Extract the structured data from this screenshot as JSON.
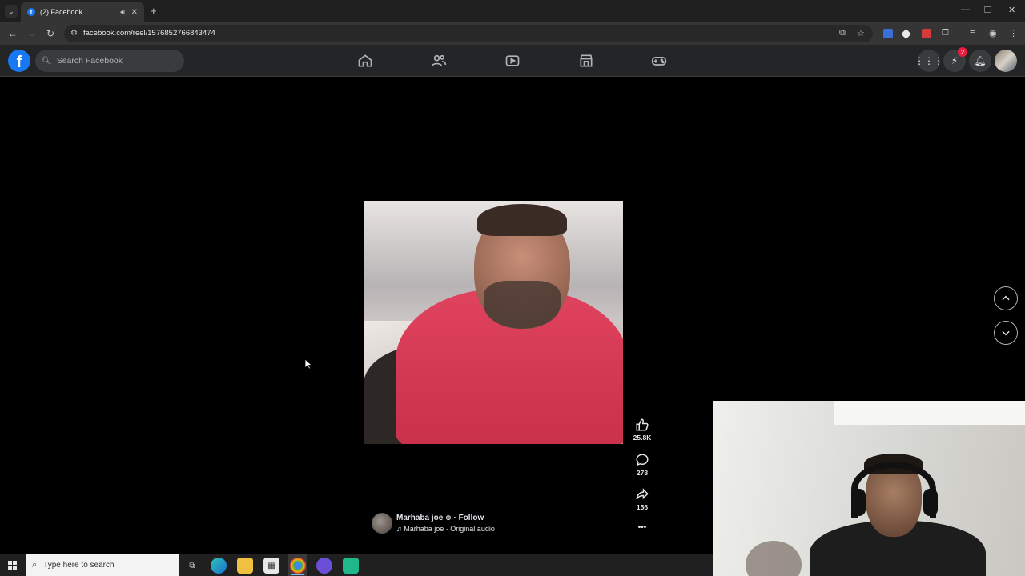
{
  "browser": {
    "tab_title": "(2) Facebook",
    "url": "facebook.com/reel/1576852766843474"
  },
  "facebook": {
    "logo_letter": "f",
    "search_placeholder": "Search Facebook",
    "messenger_badge": "2"
  },
  "reel": {
    "author": "Marhaba joe",
    "follow_label": "Follow",
    "audio": "Marhaba joe · Original audio",
    "likes": "25.8K",
    "comments": "278",
    "shares": "156",
    "more_label": "•••"
  },
  "taskbar": {
    "search_placeholder": "Type here to search"
  },
  "colors": {
    "facebook_blue": "#1877f2",
    "fb_nav_bg": "#242526",
    "badge_red": "#e41e3f"
  }
}
